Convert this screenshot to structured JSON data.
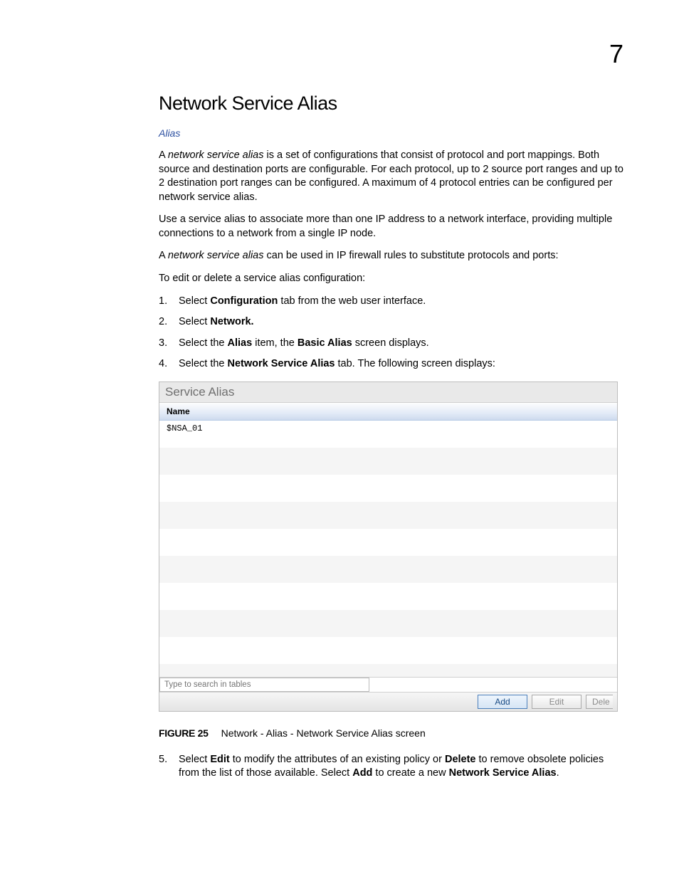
{
  "page_number": "7",
  "heading": "Network Service Alias",
  "link": "Alias",
  "p1_a": "A ",
  "p1_italic": "network service alias",
  "p1_b": " is a set of configurations that consist of protocol and port mappings. Both source and destination ports are configurable. For each protocol, up to 2 source port ranges and up to 2 destination port ranges can be configured. A maximum of 4 protocol entries can be configured per network service alias.",
  "p2": "Use a service alias to associate more than one IP address to a network interface, providing multiple connections to a network from a single IP node.",
  "p3_a": "A ",
  "p3_italic": "network service alias",
  "p3_b": " can be used in IP firewall rules to substitute protocols and ports:",
  "p4": "To edit or delete a service alias configuration:",
  "steps": {
    "s1_a": "Select ",
    "s1_b": "Configuration",
    "s1_c": " tab from the web user interface.",
    "s2_a": "Select ",
    "s2_b": "Network.",
    "s3_a": "Select the ",
    "s3_b": "Alias",
    "s3_c": " item, the ",
    "s3_d": "Basic Alias",
    "s3_e": " screen displays.",
    "s4_a": "Select the ",
    "s4_b": "Network Service Alias",
    "s4_c": " tab. The following screen displays:"
  },
  "screenshot": {
    "panel_title": "Service Alias",
    "column_header": "Name",
    "row1": "$NSA_01",
    "search_placeholder": "Type to search in tables",
    "btn_add": "Add",
    "btn_edit": "Edit",
    "btn_delete": "Dele"
  },
  "figure_label": "FIGURE 25",
  "figure_caption": "Network - Alias - Network Service Alias screen",
  "step5_a": "Select ",
  "step5_b": "Edit",
  "step5_c": " to modify the attributes of an existing policy or ",
  "step5_d": "Delete",
  "step5_e": " to remove obsolete policies from the list of those available. Select ",
  "step5_f": "Add",
  "step5_g": " to create a new ",
  "step5_h": "Network Service Alias",
  "step5_i": "."
}
